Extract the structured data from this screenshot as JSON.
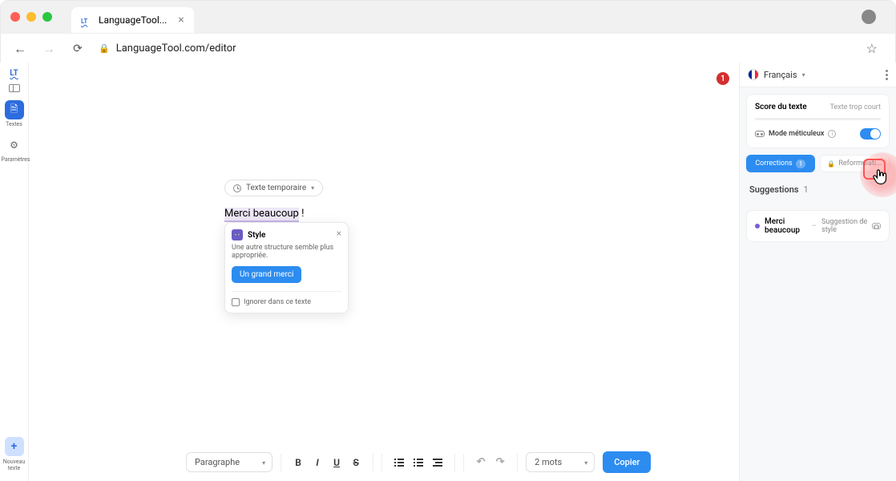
{
  "browser": {
    "tab_title": "LanguageTool...",
    "url": "LanguageTool.com/editor"
  },
  "sidebar": {
    "textes": {
      "label": "Textes"
    },
    "parametres": {
      "label": "Paramètres"
    },
    "nouveau": {
      "label": "Nouveau\ntexte"
    }
  },
  "document": {
    "pill_label": "Texte temporaire",
    "highlighted_text": "Merci beaucoup",
    "trailing_text": " !",
    "error_count": "1"
  },
  "popup": {
    "category": "Style",
    "description": "Une autre structure semble plus appropriée.",
    "suggestion_button": "Un grand merci",
    "ignore_label": "Ignorer dans ce texte"
  },
  "toolbar": {
    "format_select": "Paragraphe",
    "word_count": "2 mots",
    "copy_button": "Copier"
  },
  "panel": {
    "language": "Français",
    "score_title": "Score du texte",
    "score_sub": "Texte trop court",
    "picky_label": "Mode méticuleux",
    "tabs": {
      "corrections": "Corrections",
      "corrections_count": "1",
      "reformulations": "Reformulati..."
    },
    "suggestions_heading": "Suggestions",
    "suggestions_count": "1",
    "item": {
      "phrase": "Merci beaucoup",
      "type": "Suggestion de style"
    }
  }
}
